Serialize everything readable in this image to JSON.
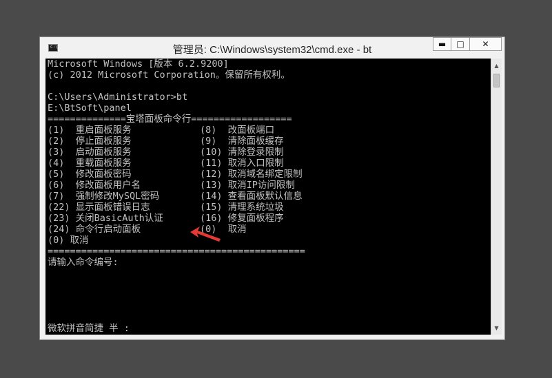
{
  "window": {
    "title": "管理员: C:\\Windows\\system32\\cmd.exe - bt",
    "icon_text": "C:\\",
    "controls": {
      "minimize": "▬",
      "maximize": "□",
      "close": "✕"
    }
  },
  "console": {
    "lines": [
      "Microsoft Windows [版本 6.2.9200]",
      "(c) 2012 Microsoft Corporation。保留所有权利。",
      "",
      "C:\\Users\\Administrator>bt",
      "E:\\BtSoft\\panel",
      "==============宝塔面板命令行=================="
    ],
    "menu": [
      {
        "left": "(1)  重启面板服务",
        "right": "(8)  改面板端口"
      },
      {
        "left": "(2)  停止面板服务",
        "right": "(9)  清除面板缓存"
      },
      {
        "left": "(3)  启动面板服务",
        "right": "(10) 清除登录限制"
      },
      {
        "left": "(4)  重载面板服务",
        "right": "(11) 取消入口限制"
      },
      {
        "left": "(5)  修改面板密码",
        "right": "(12) 取消域名绑定限制"
      },
      {
        "left": "(6)  修改面板用户名",
        "right": "(13) 取消IP访问限制"
      },
      {
        "left": "(7)  强制修改MySQL密码",
        "right": "(14) 查看面板默认信息"
      },
      {
        "left": "(22) 显示面板错误日志",
        "right": "(15) 清理系统垃圾"
      },
      {
        "left": "(23) 关闭BasicAuth认证",
        "right": "(16) 修复面板程序"
      },
      {
        "left": "(24) 命令行启动面板",
        "right": "(0)  取消"
      }
    ],
    "after": [
      "(0) 取消",
      "==============================================",
      "请输入命令编号:"
    ],
    "ime_status": "微软拼音简捷 半 :"
  },
  "colors": {
    "console_bg": "#000000",
    "console_text": "#c0c0c0",
    "annotation_arrow": "#e53935"
  }
}
